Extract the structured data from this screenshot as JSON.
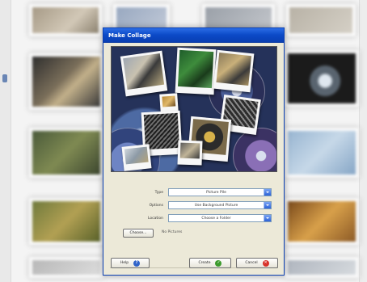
{
  "dialog": {
    "title": "Make Collage",
    "fields": [
      {
        "label": "Type",
        "value": "Picture Pile"
      },
      {
        "label": "Options",
        "value": "Use Background Picture"
      },
      {
        "label": "Location",
        "value": "Choose a Folder"
      }
    ],
    "choose_button": "Choose...",
    "choose_status": "No Pictures",
    "buttons": {
      "help": "Help",
      "create": "Create",
      "cancel": "Cancel"
    }
  },
  "icons": {
    "help": "help-icon",
    "create": "checkmark-icon",
    "cancel": "cancel-icon",
    "dropdown": "chevron-down-icon"
  },
  "colors": {
    "titlebar": "#0b49c6",
    "dialog_bg": "#ece9d8",
    "help_icon": "#2f63c9",
    "ok_icon": "#3b9a2c",
    "cancel_icon": "#d7322a"
  }
}
